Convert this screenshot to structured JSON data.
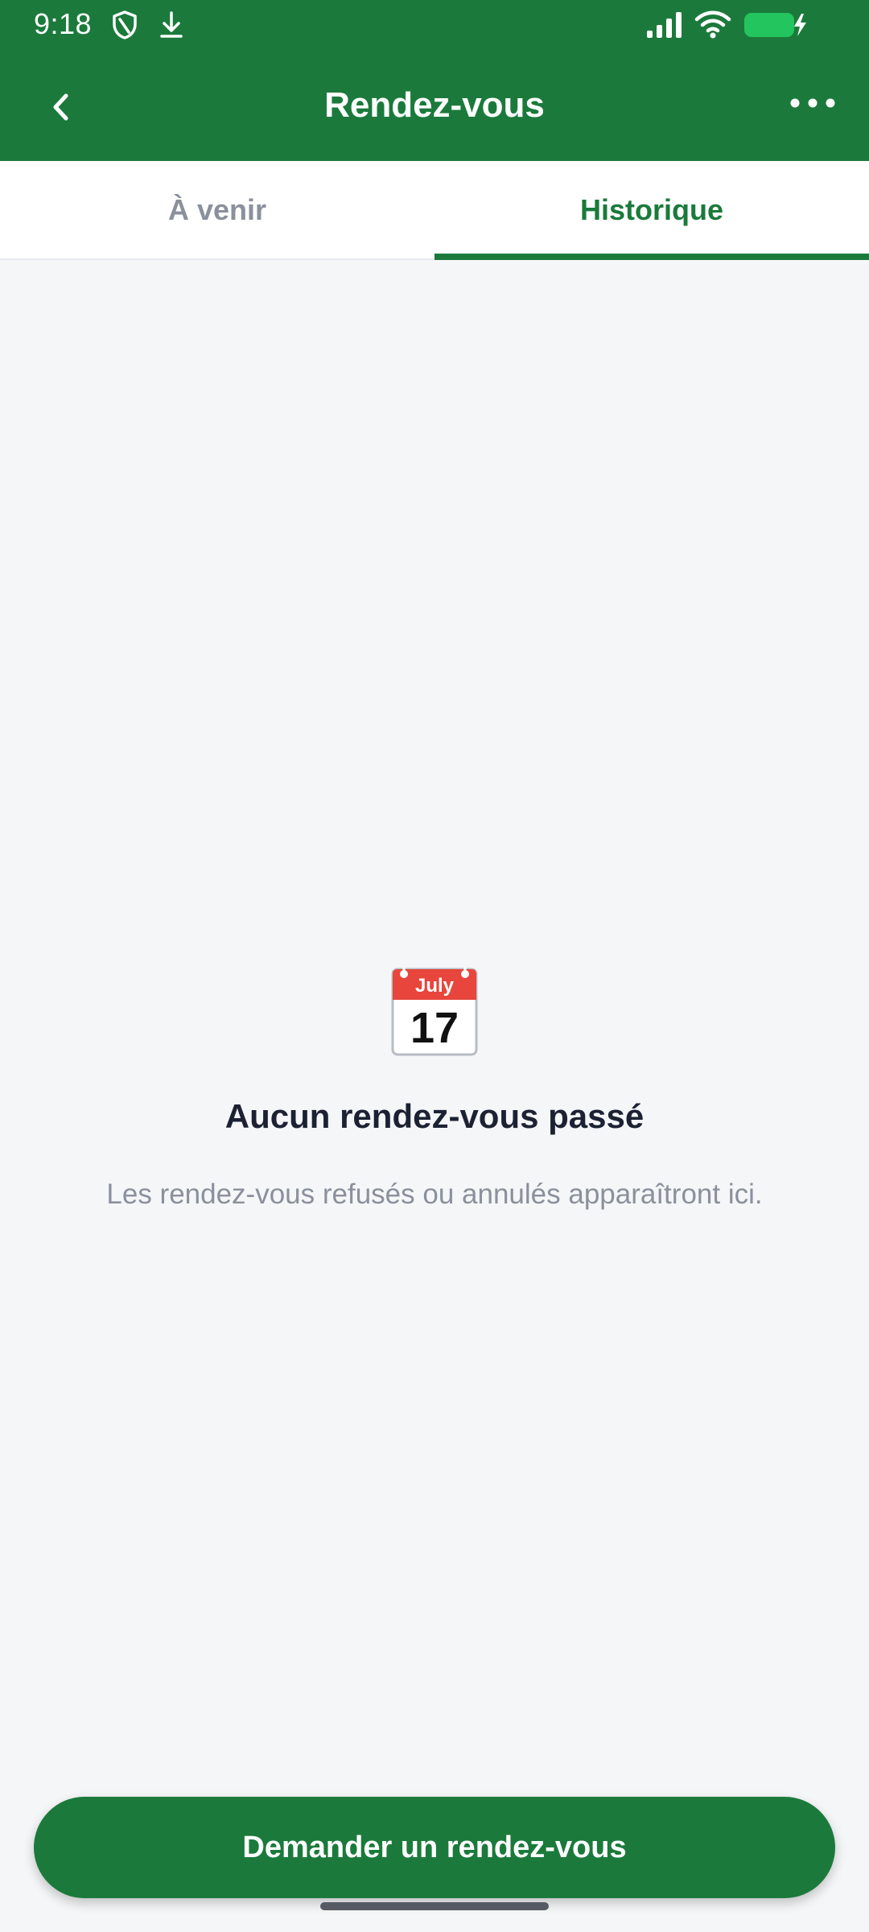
{
  "status_bar": {
    "time": "9:18",
    "icons": [
      "shield-icon",
      "download-icon",
      "signal-icon",
      "wifi-icon",
      "battery-charging-icon"
    ]
  },
  "app_bar": {
    "title": "Rendez-vous",
    "back_icon": "chevron-left-icon",
    "more_icon": "more-horizontal-icon"
  },
  "tabs": [
    {
      "label": "À venir",
      "active": false
    },
    {
      "label": "Historique",
      "active": true
    }
  ],
  "empty_state": {
    "icon": "calendar-icon",
    "calendar_month": "July",
    "calendar_day": "17",
    "title": "Aucun rendez-vous passé",
    "subtitle": "Les rendez-vous refusés ou annulés apparaîtront ici."
  },
  "cta": {
    "label": "Demander un rendez-vous"
  },
  "colors": {
    "primary": "#1b7a3b",
    "background": "#f5f6f8",
    "inactive_tab": "#8a909c",
    "calendar_red": "#e8453c"
  }
}
